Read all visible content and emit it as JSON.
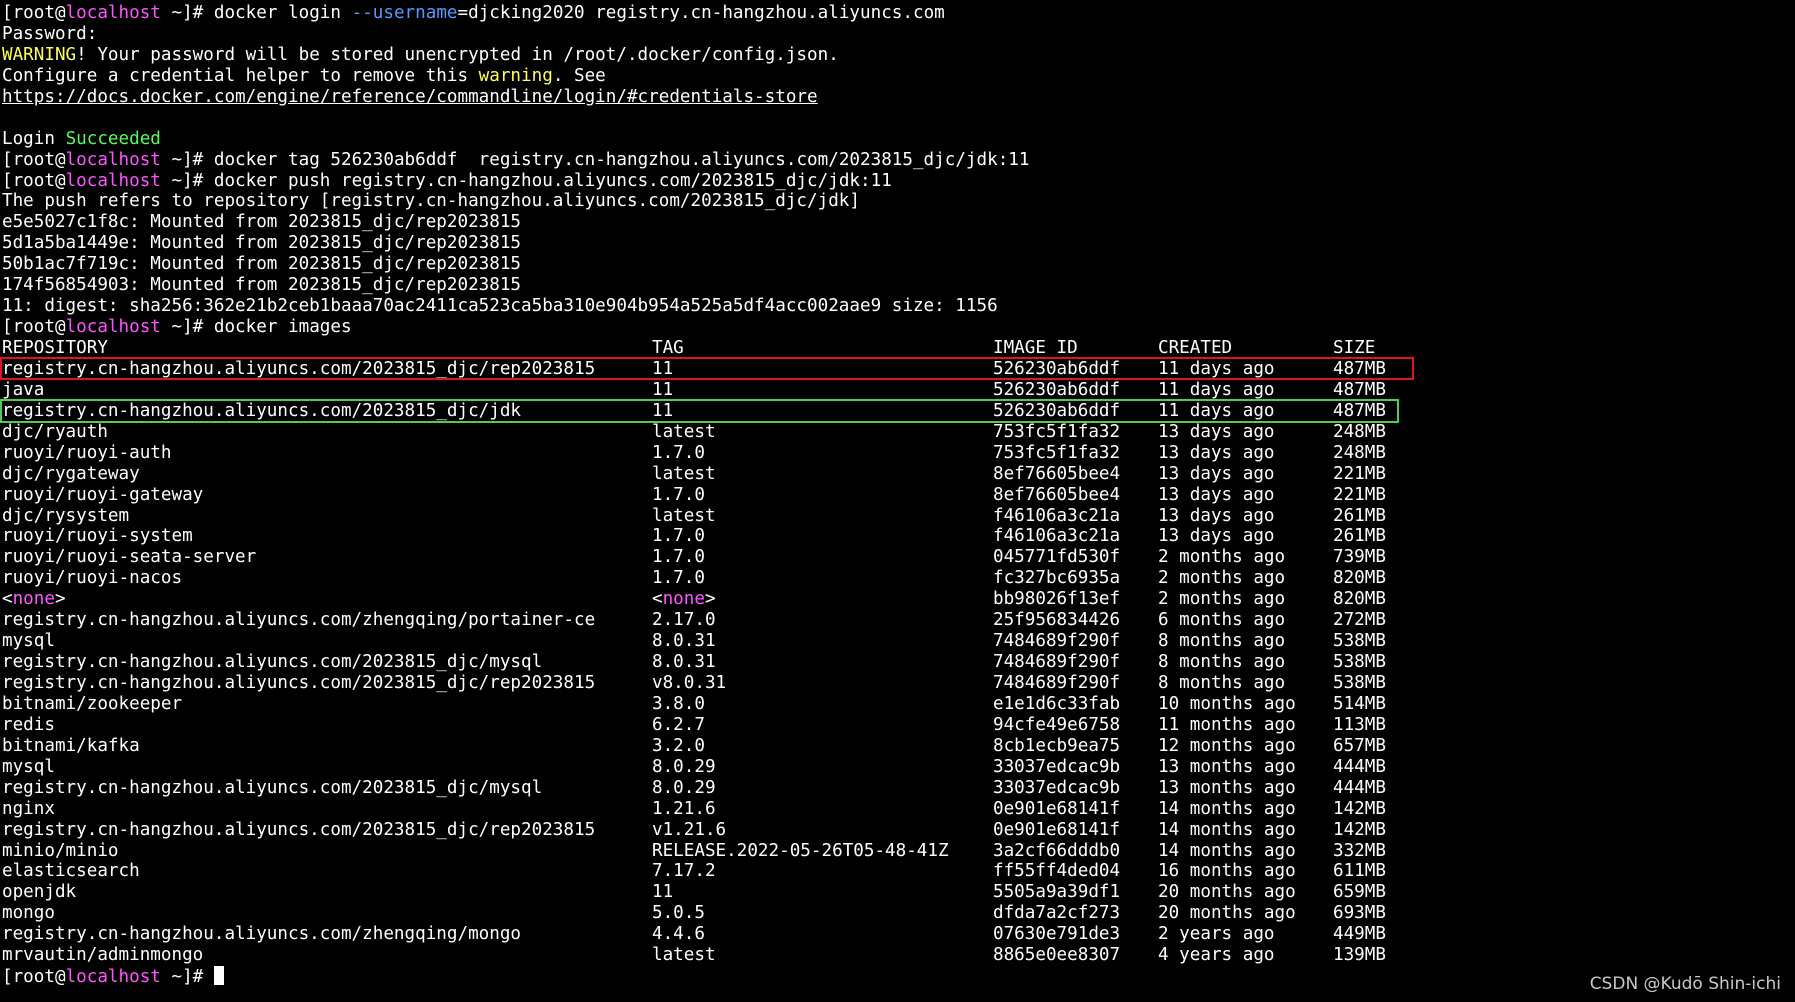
{
  "prompt": {
    "user": "[root@",
    "host": "localhost",
    "suffix": " ~]# "
  },
  "session": {
    "login_cmd_a": "docker login ",
    "login_cmd_opt": "--username",
    "login_cmd_b": "=djcking2020 registry.cn-hangzhou.aliyuncs.com",
    "password_line": "Password:",
    "warning_word": "WARNING",
    "warning_rest": "! Your password will be stored unencrypted in /root/.docker/config.json.",
    "configure_a": "Configure a credential helper to remove this ",
    "configure_warn": "warning",
    "configure_b": ". See",
    "docs_link": "https://docs.docker.com/engine/reference/commandline/login/#credentials-store",
    "login_word": "Login ",
    "succeeded_word": "Succeeded",
    "tag_cmd": "docker tag 526230ab6ddf  registry.cn-hangzhou.aliyuncs.com/2023815_djc/jdk:11",
    "push_cmd": "docker push registry.cn-hangzhou.aliyuncs.com/2023815_djc/jdk:11",
    "push_refers": "The push refers to repository [registry.cn-hangzhou.aliyuncs.com/2023815_djc/jdk]",
    "mounted": [
      "e5e5027c1f8c: Mounted from 2023815_djc/rep2023815",
      "5d1a5ba1449e: Mounted from 2023815_djc/rep2023815",
      "50b1ac7f719c: Mounted from 2023815_djc/rep2023815",
      "174f56854903: Mounted from 2023815_djc/rep2023815"
    ],
    "digest_line": "11: digest: sha256:362e21b2ceb1baaa70ac2411ca523ca5ba310e904b954a525a5df4acc002aae9 size: 1156",
    "images_cmd": "docker images"
  },
  "table": {
    "headers": [
      "REPOSITORY",
      "TAG",
      "IMAGE ID",
      "CREATED",
      "SIZE"
    ],
    "rows": [
      [
        "registry.cn-hangzhou.aliyuncs.com/2023815_djc/rep2023815",
        "11",
        "526230ab6ddf",
        "11 days ago",
        "487MB"
      ],
      [
        "java",
        "11",
        "526230ab6ddf",
        "11 days ago",
        "487MB"
      ],
      [
        "registry.cn-hangzhou.aliyuncs.com/2023815_djc/jdk",
        "11",
        "526230ab6ddf",
        "11 days ago",
        "487MB"
      ],
      [
        "djc/ryauth",
        "latest",
        "753fc5f1fa32",
        "13 days ago",
        "248MB"
      ],
      [
        "ruoyi/ruoyi-auth",
        "1.7.0",
        "753fc5f1fa32",
        "13 days ago",
        "248MB"
      ],
      [
        "djc/rygateway",
        "latest",
        "8ef76605bee4",
        "13 days ago",
        "221MB"
      ],
      [
        "ruoyi/ruoyi-gateway",
        "1.7.0",
        "8ef76605bee4",
        "13 days ago",
        "221MB"
      ],
      [
        "djc/rysystem",
        "latest",
        "f46106a3c21a",
        "13 days ago",
        "261MB"
      ],
      [
        "ruoyi/ruoyi-system",
        "1.7.0",
        "f46106a3c21a",
        "13 days ago",
        "261MB"
      ],
      [
        "ruoyi/ruoyi-seata-server",
        "1.7.0",
        "045771fd530f",
        "2 months ago",
        "739MB"
      ],
      [
        "ruoyi/ruoyi-nacos",
        "1.7.0",
        "fc327bc6935a",
        "2 months ago",
        "820MB"
      ],
      [
        "<none>",
        "<none>",
        "bb98026f13ef",
        "2 months ago",
        "820MB"
      ],
      [
        "registry.cn-hangzhou.aliyuncs.com/zhengqing/portainer-ce",
        "2.17.0",
        "25f956834426",
        "6 months ago",
        "272MB"
      ],
      [
        "mysql",
        "8.0.31",
        "7484689f290f",
        "8 months ago",
        "538MB"
      ],
      [
        "registry.cn-hangzhou.aliyuncs.com/2023815_djc/mysql",
        "8.0.31",
        "7484689f290f",
        "8 months ago",
        "538MB"
      ],
      [
        "registry.cn-hangzhou.aliyuncs.com/2023815_djc/rep2023815",
        "v8.0.31",
        "7484689f290f",
        "8 months ago",
        "538MB"
      ],
      [
        "bitnami/zookeeper",
        "3.8.0",
        "e1e1d6c33fab",
        "10 months ago",
        "514MB"
      ],
      [
        "redis",
        "6.2.7",
        "94cfe49e6758",
        "11 months ago",
        "113MB"
      ],
      [
        "bitnami/kafka",
        "3.2.0",
        "8cb1ecb9ea75",
        "12 months ago",
        "657MB"
      ],
      [
        "mysql",
        "8.0.29",
        "33037edcac9b",
        "13 months ago",
        "444MB"
      ],
      [
        "registry.cn-hangzhou.aliyuncs.com/2023815_djc/mysql",
        "8.0.29",
        "33037edcac9b",
        "13 months ago",
        "444MB"
      ],
      [
        "nginx",
        "1.21.6",
        "0e901e68141f",
        "14 months ago",
        "142MB"
      ],
      [
        "registry.cn-hangzhou.aliyuncs.com/2023815_djc/rep2023815",
        "v1.21.6",
        "0e901e68141f",
        "14 months ago",
        "142MB"
      ],
      [
        "minio/minio",
        "RELEASE.2022-05-26T05-48-41Z",
        "3a2cf66dddb0",
        "14 months ago",
        "332MB"
      ],
      [
        "elasticsearch",
        "7.17.2",
        "ff55ff4ded04",
        "16 months ago",
        "611MB"
      ],
      [
        "openjdk",
        "11",
        "5505a9a39df1",
        "20 months ago",
        "659MB"
      ],
      [
        "mongo",
        "5.0.5",
        "dfda7a2cf273",
        "20 months ago",
        "693MB"
      ],
      [
        "registry.cn-hangzhou.aliyuncs.com/zhengqing/mongo",
        "4.4.6",
        "07630e791de3",
        "2 years ago",
        "449MB"
      ],
      [
        "mrvautin/adminmongo",
        "latest",
        "8865e0ee8307",
        "4 years ago",
        "139MB"
      ]
    ]
  },
  "watermark": "CSDN @Kudō Shin-ichi",
  "colors": {
    "background": "#000000",
    "text": "#ffffff",
    "host": "#ff55ff",
    "warning": "#ffff55",
    "success": "#55ff55",
    "option": "#5599ff",
    "highlight_red": "#e0141e",
    "highlight_green": "#4ccf4c"
  }
}
